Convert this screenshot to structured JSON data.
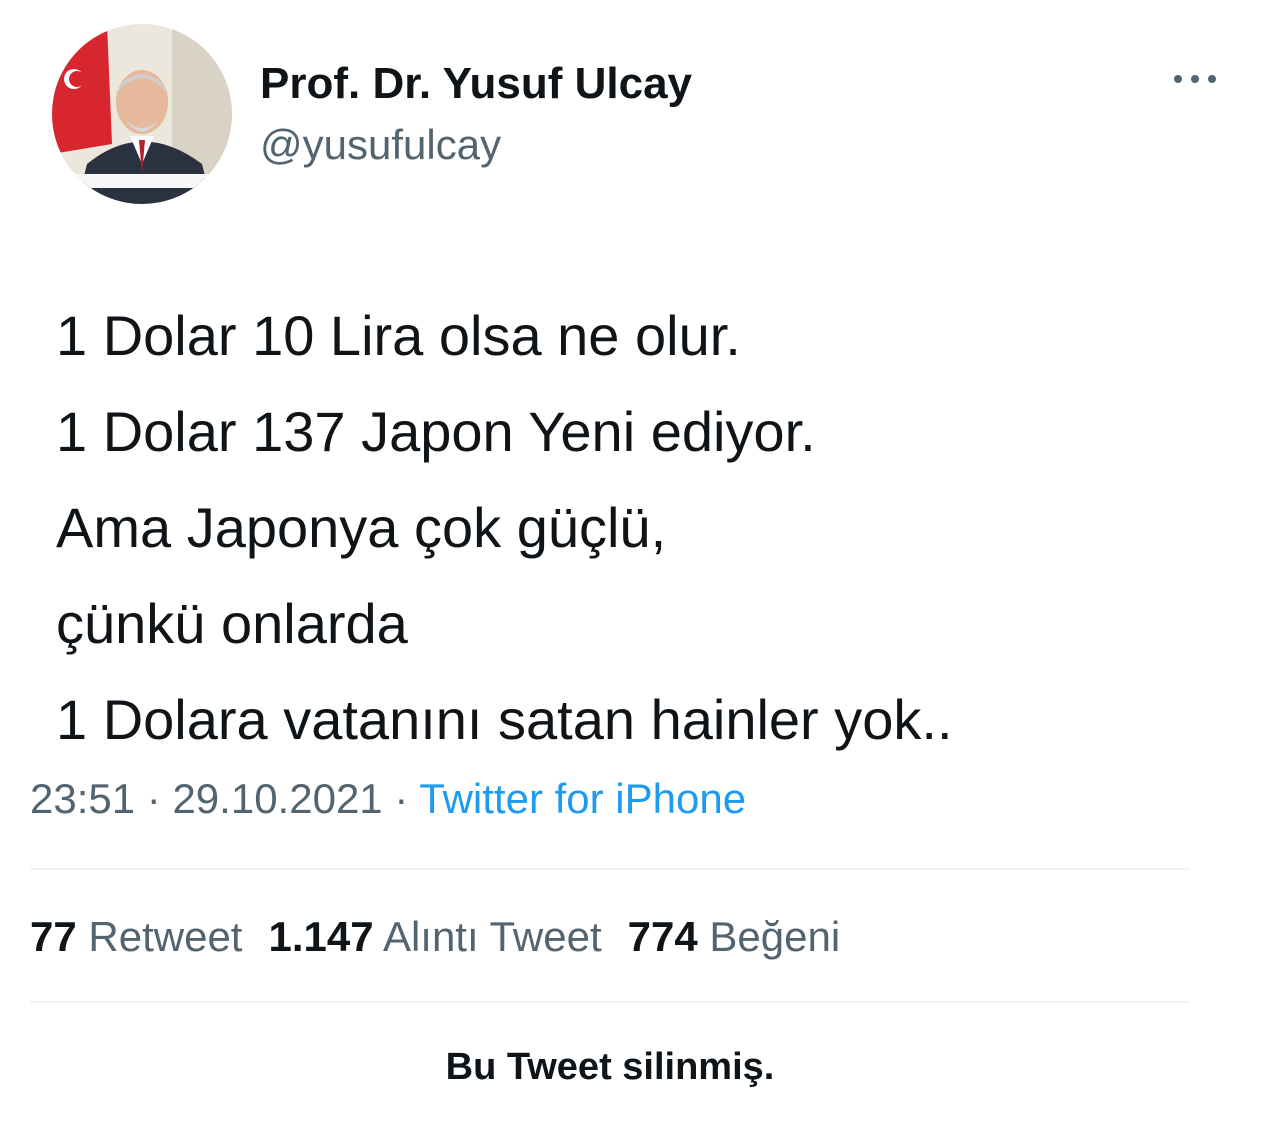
{
  "author": {
    "display_name": "Prof. Dr. Yusuf Ulcay",
    "handle": "@yusufulcay",
    "avatar_icon": "profile-photo"
  },
  "tweet": {
    "lines": [
      "1 Dolar 10 Lira olsa ne olur.",
      "1 Dolar 137 Japon Yeni ediyor.",
      "Ama Japonya çok güçlü,",
      "çünkü onlarda",
      "1 Dolara vatanını satan hainler yok.."
    ],
    "time": "23:51",
    "separator": "·",
    "date": "29.10.2021",
    "source": "Twitter for iPhone"
  },
  "stats": {
    "retweets_count": "77",
    "retweets_label": "Retweet",
    "quotes_count": "1.147",
    "quotes_label": "Alıntı Tweet",
    "likes_count": "774",
    "likes_label": "Beğeni"
  },
  "notice": "Bu Tweet silinmiş.",
  "colors": {
    "text_primary": "#0f1419",
    "text_secondary": "#536471",
    "link": "#1d9bf0",
    "divider": "#eff3f4"
  },
  "icons": {
    "more": "more-horizontal-icon"
  }
}
